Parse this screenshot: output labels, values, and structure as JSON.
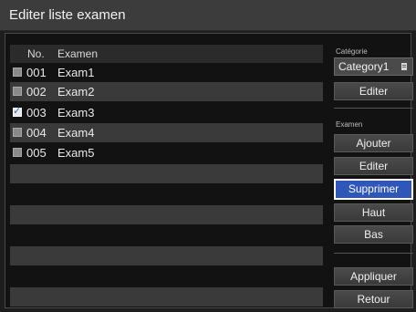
{
  "window": {
    "title": "Editer liste examen"
  },
  "list": {
    "columns": {
      "no": "No.",
      "exam": "Examen"
    },
    "rows": [
      {
        "no": "001",
        "name": "Exam1",
        "checked": false
      },
      {
        "no": "002",
        "name": "Exam2",
        "checked": false
      },
      {
        "no": "003",
        "name": "Exam3",
        "checked": true
      },
      {
        "no": "004",
        "name": "Exam4",
        "checked": false
      },
      {
        "no": "005",
        "name": "Exam5",
        "checked": false
      }
    ]
  },
  "side": {
    "category_label": "Catégorie",
    "category_value": "Category1",
    "category_icon": "document-icon",
    "category_edit": "Editer",
    "exam_label": "Examen",
    "buttons": {
      "add": "Ajouter",
      "edit": "Editer",
      "delete": "Supprimer",
      "up": "Haut",
      "down": "Bas",
      "apply": "Appliquer",
      "back": "Retour"
    }
  },
  "colors": {
    "accent": "#2f56b9",
    "row_alt": "#3a3a3a"
  }
}
